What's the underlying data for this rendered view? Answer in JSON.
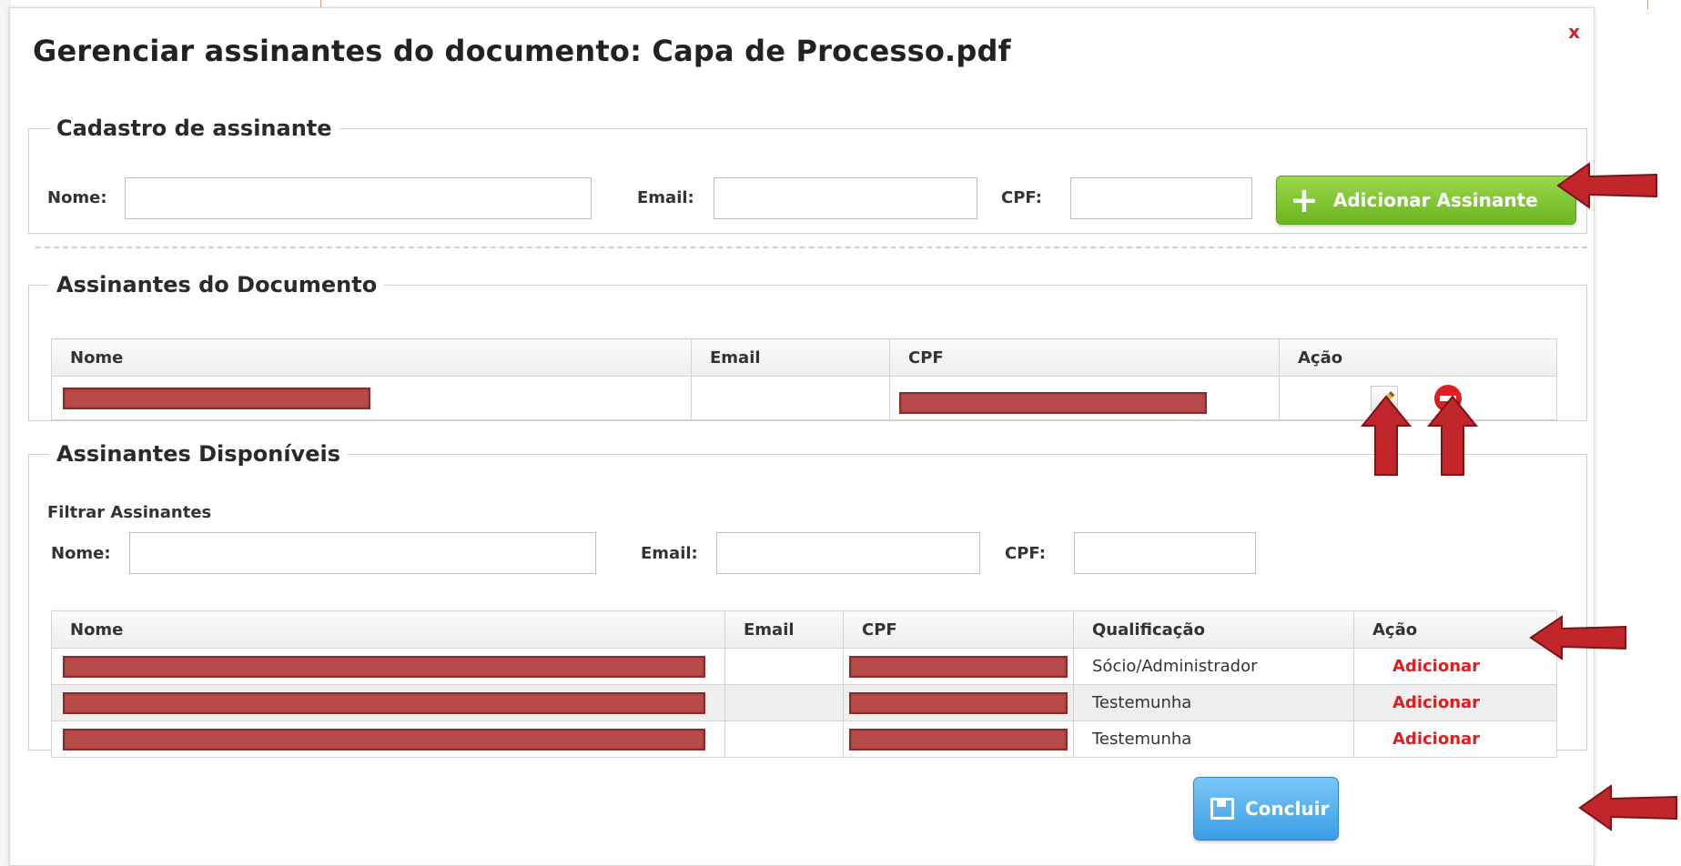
{
  "dialog": {
    "title": "Gerenciar assinantes do documento: Capa de Processo.pdf",
    "close_label": "x"
  },
  "cadastro": {
    "legend": "Cadastro de assinante",
    "nome_label": "Nome:",
    "email_label": "Email:",
    "cpf_label": "CPF:",
    "nome_value": "",
    "email_value": "",
    "cpf_value": "",
    "add_button_label": "Adicionar Assinante"
  },
  "assinantes_documento": {
    "legend": "Assinantes do Documento",
    "columns": [
      "Nome",
      "Email",
      "CPF",
      "Ação"
    ],
    "rows": [
      {
        "nome": "[redacted]",
        "email": "",
        "cpf": "[redacted]"
      }
    ]
  },
  "assinantes_disponiveis": {
    "legend": "Assinantes Disponíveis",
    "filter_title": "Filtrar Assinantes",
    "nome_label": "Nome:",
    "email_label": "Email:",
    "cpf_label": "CPF:",
    "nome_value": "",
    "email_value": "",
    "cpf_value": "",
    "columns": [
      "Nome",
      "Email",
      "CPF",
      "Qualificação",
      "Ação"
    ],
    "rows": [
      {
        "nome": "[redacted]",
        "email": "",
        "cpf": "[redacted]",
        "qualificacao": "Sócio/Administrador",
        "acao": "Adicionar"
      },
      {
        "nome": "[redacted]",
        "email": "",
        "cpf": "[redacted]",
        "qualificacao": "Testemunha",
        "acao": "Adicionar"
      },
      {
        "nome": "[redacted]",
        "email": "",
        "cpf": "[redacted]",
        "qualificacao": "Testemunha",
        "acao": "Adicionar"
      }
    ]
  },
  "footer": {
    "concluir_label": "Concluir"
  },
  "colors": {
    "add_button": "#7cc52f",
    "concluir_button": "#4aa8ec",
    "action_link": "#e31b1b",
    "redaction": "#b84a4a",
    "annotation_arrow": "#c0262a"
  },
  "icons": {
    "edit": "pencil-icon",
    "remove": "stop-icon",
    "add": "plus-icon",
    "save": "floppy-disk-icon",
    "annotation": "red-arrow-icon"
  }
}
